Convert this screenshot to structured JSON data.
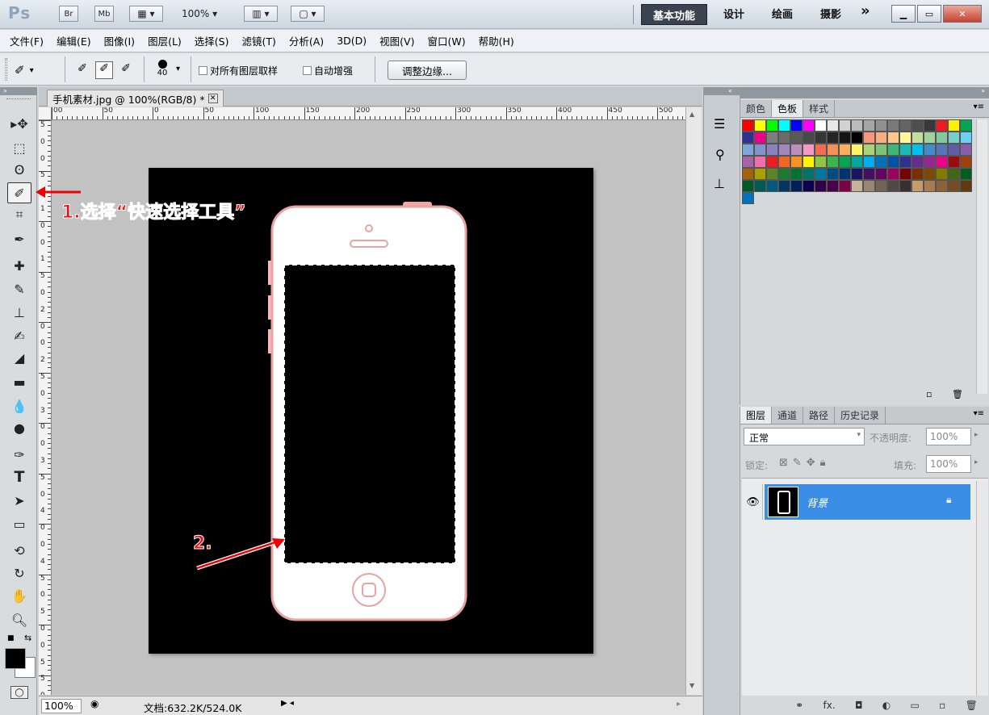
{
  "app": {
    "logo": "Ps",
    "br": "Br",
    "mb": "Mb",
    "zoom": "100%",
    "workspaces": [
      "基本功能",
      "设计",
      "绘画",
      "摄影"
    ],
    "more": "»"
  },
  "menu": [
    "文件(F)",
    "编辑(E)",
    "图像(I)",
    "图层(L)",
    "选择(S)",
    "滤镜(T)",
    "分析(A)",
    "3D(D)",
    "视图(V)",
    "窗口(W)",
    "帮助(H)"
  ],
  "options": {
    "brush_size": "40",
    "sample_all": "对所有图层取样",
    "auto_enhance": "自动增强",
    "refine_edge": "调整边缘..."
  },
  "document": {
    "tab_title": "手机素材.jpg @ 100%(RGB/8) *",
    "ruler_top": [
      "00",
      "50",
      "0",
      "50",
      "100",
      "150",
      "200",
      "250",
      "300",
      "350",
      "400",
      "450",
      "500"
    ],
    "ruler_left": [
      "5",
      "0",
      "0",
      "5",
      "0",
      "1",
      "0",
      "0",
      "1",
      "5",
      "0",
      "2",
      "0",
      "0",
      "2",
      "5",
      "0",
      "3",
      "0",
      "0",
      "3",
      "5",
      "0",
      "4",
      "0",
      "0",
      "4",
      "5",
      "0",
      "5",
      "0",
      "0",
      "5",
      "5",
      "0"
    ],
    "zoom": "100%",
    "doc_info": "文档:632.2K/524.0K"
  },
  "annotations": {
    "step1": "1.选择“快速选择工具”",
    "step2": "2."
  },
  "swatches_panel": {
    "tabs": [
      "颜色",
      "色板",
      "样式"
    ],
    "active_tab": "色板",
    "colors": [
      "#ff0000",
      "#ffff00",
      "#00ff00",
      "#00ffff",
      "#0000ff",
      "#ff00ff",
      "#ffffff",
      "#e8e8e8",
      "#d2d2d2",
      "#bcbcbc",
      "#a6a6a6",
      "#909090",
      "#7a7a7a",
      "#646464",
      "#4e4e4e",
      "#383838",
      "#ed1c24",
      "#fff200",
      "#00a651",
      "#2e3192",
      "#ec008c",
      "#7d7d7d",
      "#6b6b6b",
      "#595959",
      "#484848",
      "#363636",
      "#252525",
      "#141414",
      "#000000",
      "#f7977a",
      "#f9ad81",
      "#fdc68a",
      "#fff79a",
      "#c4df9b",
      "#a2d39c",
      "#82ca9d",
      "#7bcdc8",
      "#6ecff6",
      "#7ea7d8",
      "#8493ca",
      "#8882be",
      "#a187be",
      "#bc8dbf",
      "#f49ac2",
      "#f26c4f",
      "#f68e56",
      "#fbaf5d",
      "#fff467",
      "#acd373",
      "#7cc576",
      "#3bb878",
      "#1abbb4",
      "#00bff3",
      "#438ccb",
      "#5574b9",
      "#605ca8",
      "#855fa8",
      "#a763a8",
      "#f06ea9",
      "#ed1c24",
      "#f26522",
      "#f7941d",
      "#fff200",
      "#8dc73f",
      "#39b54a",
      "#00a651",
      "#00a99d",
      "#00aeef",
      "#0072bc",
      "#0054a6",
      "#2e3192",
      "#662d91",
      "#92278f",
      "#ec008c",
      "#9e0b0f",
      "#a0410d",
      "#a36209",
      "#aba000",
      "#598527",
      "#1a7b30",
      "#007236",
      "#00746b",
      "#0076a3",
      "#004b80",
      "#003471",
      "#1b1464",
      "#440e62",
      "#630460",
      "#9e005d",
      "#790000",
      "#7b2e00",
      "#7d4900",
      "#827b00",
      "#406618",
      "#005e20",
      "#005826",
      "#005952",
      "#005b7f",
      "#003663",
      "#002157",
      "#0d004c",
      "#32004b",
      "#4b0049",
      "#7b0046",
      "#c7b299",
      "#998675",
      "#736357",
      "#534741",
      "#37302d",
      "#c69c6d",
      "#a67c52",
      "#8c6239",
      "#754c24",
      "#603913",
      "#0072bc"
    ]
  },
  "layers_panel": {
    "tabs": [
      "图层",
      "通道",
      "路径",
      "历史记录"
    ],
    "blend_mode": "正常",
    "opacity_label": "不透明度:",
    "opacity": "100%",
    "lock_label": "锁定:",
    "fill_label": "填充:",
    "fill": "100%",
    "layer_name": "背景"
  }
}
